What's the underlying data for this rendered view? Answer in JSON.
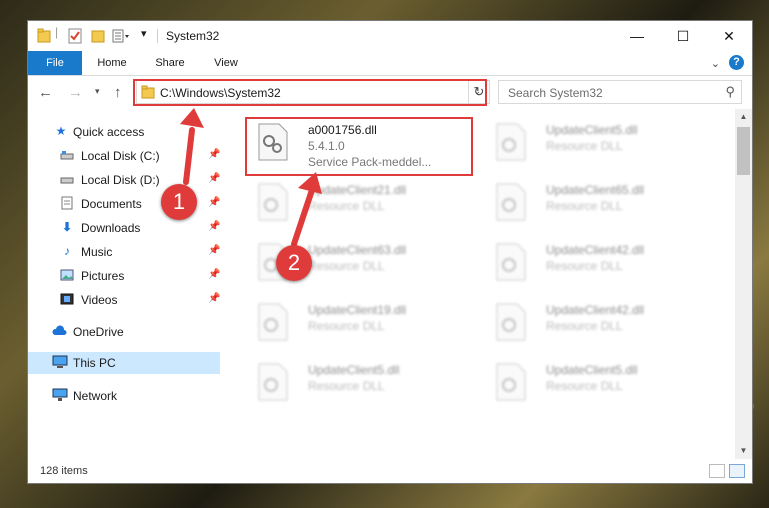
{
  "window": {
    "title": "System32"
  },
  "ribbon": {
    "tabs": [
      "File",
      "Home",
      "Share",
      "View"
    ]
  },
  "address": {
    "path": "C:\\Windows\\System32"
  },
  "search": {
    "placeholder": "Search System32"
  },
  "sidebar": {
    "items": [
      {
        "label": "Quick access",
        "icon": "star-icon"
      },
      {
        "label": "Local Disk (C:)",
        "icon": "drive-icon",
        "pinned": true
      },
      {
        "label": "Local Disk (D:)",
        "icon": "drive-icon",
        "pinned": true
      },
      {
        "label": "Documents",
        "icon": "documents-icon",
        "pinned": true
      },
      {
        "label": "Downloads",
        "icon": "downloads-icon",
        "pinned": true
      },
      {
        "label": "Music",
        "icon": "music-icon",
        "pinned": true
      },
      {
        "label": "Pictures",
        "icon": "pictures-icon",
        "pinned": true
      },
      {
        "label": "Videos",
        "icon": "videos-icon",
        "pinned": true
      },
      {
        "label": "OneDrive",
        "icon": "cloud-icon"
      },
      {
        "label": "This PC",
        "icon": "pc-icon",
        "selected": true
      },
      {
        "label": "Network",
        "icon": "network-icon"
      }
    ]
  },
  "files": {
    "highlighted": {
      "name": "a0001756.dll",
      "version": "5.4.1.0",
      "description": "Service Pack-meddel..."
    },
    "others": [
      {
        "name": "UpdateClient5.dll",
        "type": "Resource DLL"
      },
      {
        "name": "UpdateClient21.dll",
        "type": "Resource DLL"
      },
      {
        "name": "UpdateClient65.dll",
        "type": "Resource DLL"
      },
      {
        "name": "UpdateClient63.dll",
        "type": "Resource DLL"
      },
      {
        "name": "UpdateClient42.dll",
        "type": "Resource DLL"
      },
      {
        "name": "UpdateClient19.dll",
        "type": "Resource DLL"
      },
      {
        "name": "UpdateClient42.dll",
        "type": "Resource DLL"
      },
      {
        "name": "UpdateClient5.dll",
        "type": "Resource DLL"
      },
      {
        "name": "UpdateClient5.dll",
        "type": "Resource DLL"
      }
    ]
  },
  "status": {
    "count": "128 items"
  },
  "annotations": {
    "badge1": "1",
    "badge2": "2"
  },
  "colors": {
    "accent": "#1979ca",
    "annotation": "#e03b3b",
    "selection": "#cce8ff"
  }
}
